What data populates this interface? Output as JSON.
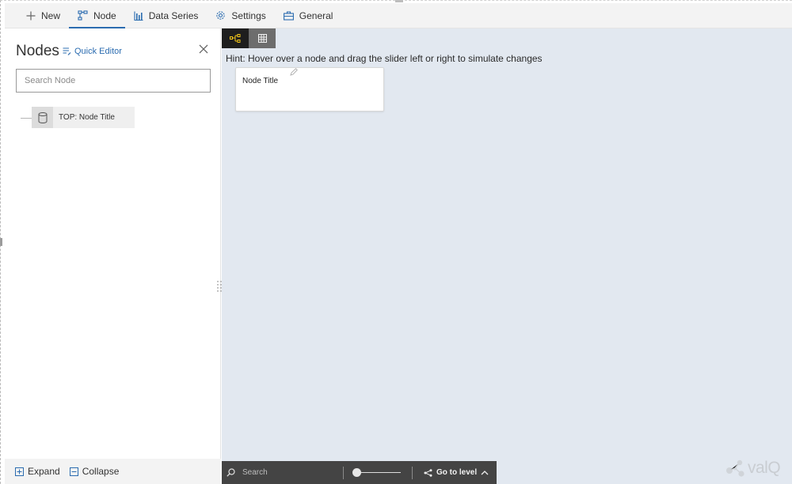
{
  "tabs": [
    {
      "label": "New",
      "icon": "plus-icon"
    },
    {
      "label": "Node",
      "icon": "node-icon",
      "active": true
    },
    {
      "label": "Data Series",
      "icon": "bar-chart-icon"
    },
    {
      "label": "Settings",
      "icon": "gear-icon"
    },
    {
      "label": "General",
      "icon": "briefcase-icon"
    }
  ],
  "left_panel": {
    "title": "Nodes",
    "quick_editor": "Quick Editor",
    "search_placeholder": "Search Node",
    "tree": [
      {
        "label": "TOP: Node Title",
        "icon": "database-icon"
      }
    ],
    "footer": {
      "expand": "Expand",
      "collapse": "Collapse"
    }
  },
  "canvas": {
    "hint": "Hint: Hover over a node and drag the slider left or right to simulate changes",
    "node_card": {
      "title": "Node Title"
    }
  },
  "bottom_bar": {
    "search_placeholder": "Search",
    "go_to_level": "Go to level",
    "slider_value": 0
  },
  "logo": {
    "text": "valQ"
  },
  "colors": {
    "accent": "#2b6cb0",
    "canvas_bg": "#e2e8f0",
    "toolbar_bg": "#444444",
    "graph_active": "#f0c419"
  }
}
